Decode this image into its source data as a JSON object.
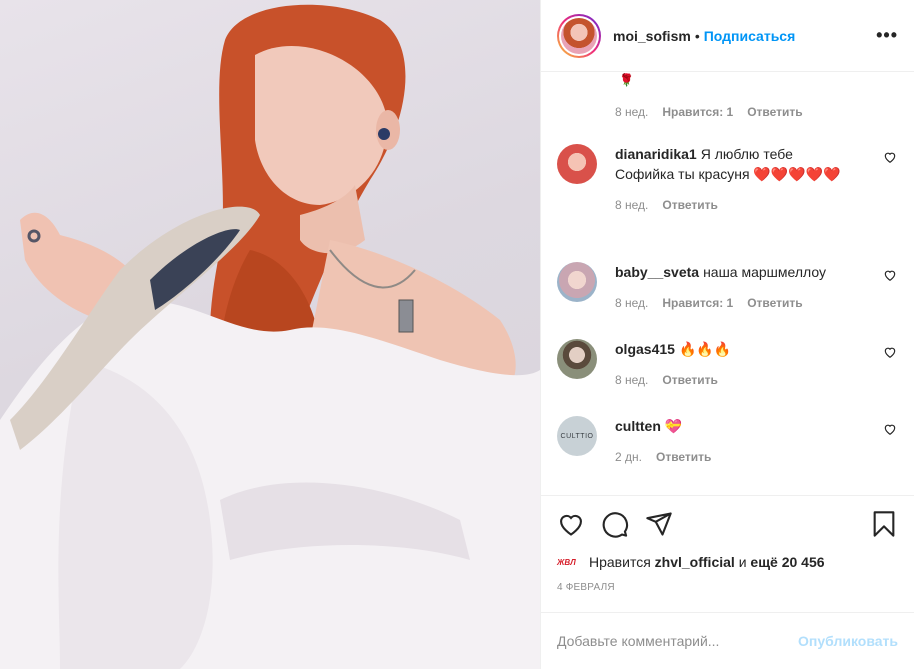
{
  "post": {
    "photo_alt": "",
    "author": "moi_sofism",
    "separator": "•",
    "follow_label": "Подписаться",
    "more_label": "•••"
  },
  "comments": {
    "top_fragment": {
      "emoji": "🌹",
      "time": "8 нед.",
      "likes": "Нравится: 1",
      "reply": "Ответить"
    },
    "items": [
      {
        "user": "dianaridika1",
        "text": "Я люблю тебе Софийка ты красуня ❤️❤️❤️❤️❤️",
        "time": "8 нед.",
        "likes": "",
        "reply": "Ответить",
        "avatar_color": "#d9514a"
      },
      {
        "user": "baby__sveta",
        "text": "наша маршмеллоу",
        "time": "8 нед.",
        "likes": "Нравится: 1",
        "reply": "Ответить",
        "avatar_color": "#c9a6b2"
      },
      {
        "user": "olgas415",
        "text": "🔥🔥🔥",
        "time": "8 нед.",
        "likes": "",
        "reply": "Ответить",
        "avatar_color": "#8a8f7a"
      },
      {
        "user": "cultten",
        "text": "💝",
        "time": "2 дн.",
        "likes": "",
        "reply": "Ответить",
        "avatar_color": "#b8c4cc",
        "avatar_text": "CULTTIO"
      }
    ]
  },
  "actions": {
    "icons": [
      "heart-icon",
      "comment-icon",
      "share-icon",
      "bookmark-icon"
    ],
    "liked_by_prefix": "Нравится",
    "liked_by_user": "zhvl_official",
    "liked_by_and": "и",
    "liked_by_rest": "ещё 20 456",
    "liker_logo": "ЖВЛ",
    "date": "4 февраля"
  },
  "add_comment": {
    "placeholder": "Добавьте комментарий...",
    "publish_label": "Опубликовать"
  },
  "colors": {
    "accent": "#0095f6",
    "publish_disabled": "#b2dffc",
    "muted": "#8e8e8e",
    "text": "#262626"
  }
}
